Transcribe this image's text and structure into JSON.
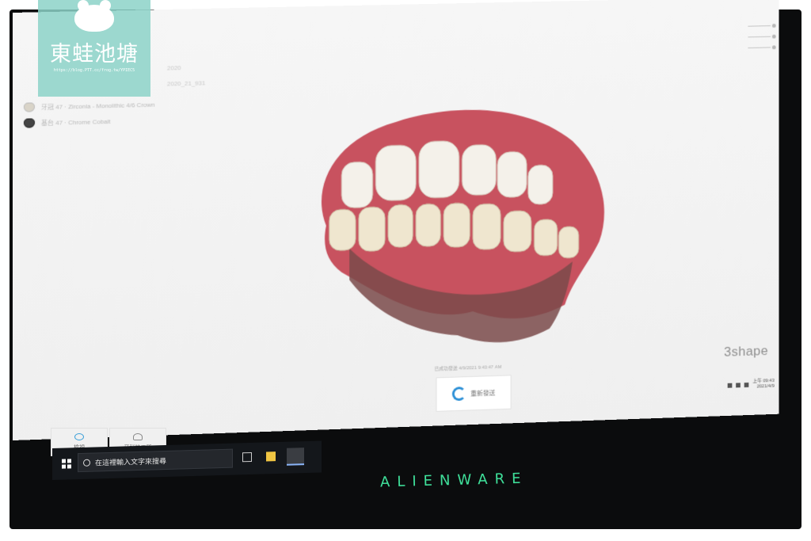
{
  "watermark": {
    "title": "東蛙池塘",
    "url": "https://blog.PTT.cc/frog.tw/YPIEC5"
  },
  "orders": [
    {
      "label": "牙冠 47 · Zirconia - Monolithic 4/6 Crown",
      "icon": "tooth-icon"
    },
    {
      "label": "基台 47 · Chrome Cobalt",
      "icon": "abutment-icon"
    }
  ],
  "faint_lines": [
    "2020",
    "2020_21_931"
  ],
  "status": {
    "timestamp": "已成功發送 4/9/2021 9:43:47 AM"
  },
  "send_button": {
    "label": "重新發送",
    "icon": "refresh-icon"
  },
  "brand": {
    "name": "3shape"
  },
  "bottom_tabs": [
    {
      "label": "檢視",
      "icon": "eye-icon"
    },
    {
      "label": "牙科技工所",
      "icon": "person-icon"
    }
  ],
  "taskbar": {
    "search_placeholder": "在這裡輸入文字來搜尋",
    "clock_time": "上午 09:43",
    "clock_date": "2021/4/9"
  },
  "monitor": {
    "brand": "ALIENWARE"
  },
  "colors": {
    "accent": "#2b8fd6",
    "alienware": "#3fe09a",
    "watermark": "#8cd2c8"
  }
}
